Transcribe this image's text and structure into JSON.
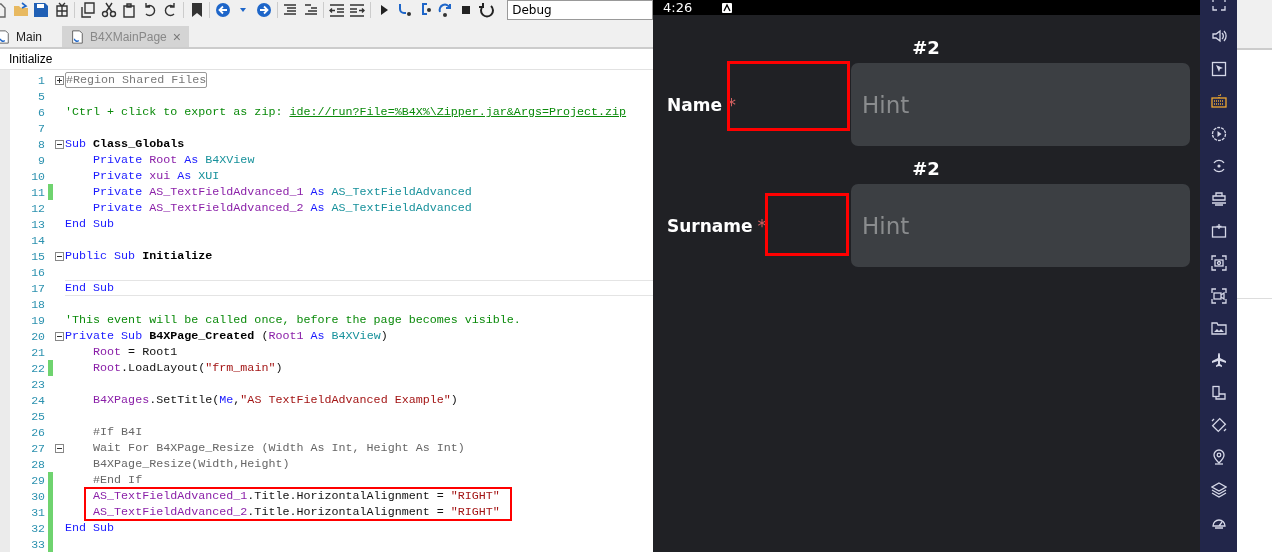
{
  "toolbar": {
    "configuration": "Debug"
  },
  "tabs": [
    {
      "label": "Main",
      "selected": false
    },
    {
      "label": "B4XMainPage",
      "selected": true,
      "close": "×"
    }
  ],
  "member_dropdown": {
    "value": "Initialize"
  },
  "code_lines": [
    {
      "number": "1",
      "collapsible": true,
      "collapsed": true,
      "changed": false,
      "current": false,
      "tokens": [
        {
          "t": "#Region Shared Files",
          "kind": "region"
        }
      ]
    },
    {
      "number": "5",
      "collapsible": false,
      "changed": false,
      "current": false
    },
    {
      "number": "6",
      "collapsible": false,
      "changed": false,
      "current": false,
      "tokens": [
        {
          "t": "'Ctrl + click to export as zip: ",
          "kind": "comment"
        },
        {
          "t": "ide://run?File=%B4X%\\Zipper.jar&Args=Project.zip",
          "kind": "link"
        }
      ]
    },
    {
      "number": "7",
      "collapsible": false,
      "changed": false,
      "current": false
    },
    {
      "number": "8",
      "collapsible": true,
      "collapsed": false,
      "changed": false,
      "current": false,
      "tokens": [
        {
          "t": "Sub ",
          "kind": "keyword"
        },
        {
          "t": "Class_Globals",
          "kind": "bold"
        }
      ]
    },
    {
      "number": "9",
      "collapsible": false,
      "changed": false,
      "current": false,
      "tokens": [
        {
          "t": "    Private ",
          "kind": "keyword"
        },
        {
          "t": "Root ",
          "kind": "ident"
        },
        {
          "t": "As ",
          "kind": "keyword"
        },
        {
          "t": "B4XView",
          "kind": "type"
        }
      ]
    },
    {
      "number": "10",
      "collapsible": false,
      "changed": false,
      "current": false,
      "tokens": [
        {
          "t": "    Private ",
          "kind": "keyword"
        },
        {
          "t": "xui ",
          "kind": "ident"
        },
        {
          "t": "As ",
          "kind": "keyword"
        },
        {
          "t": "XUI",
          "kind": "type"
        }
      ]
    },
    {
      "number": "11",
      "collapsible": false,
      "changed": true,
      "current": false,
      "tokens": [
        {
          "t": "    Private ",
          "kind": "keyword"
        },
        {
          "t": "AS_TextFieldAdvanced_1 ",
          "kind": "ident"
        },
        {
          "t": "As ",
          "kind": "keyword"
        },
        {
          "t": "AS_TextFieldAdvanced",
          "kind": "type"
        }
      ]
    },
    {
      "number": "12",
      "collapsible": false,
      "changed": false,
      "current": false,
      "tokens": [
        {
          "t": "    Private ",
          "kind": "keyword"
        },
        {
          "t": "AS_TextFieldAdvanced_2 ",
          "kind": "ident"
        },
        {
          "t": "As ",
          "kind": "keyword"
        },
        {
          "t": "AS_TextFieldAdvanced",
          "kind": "type"
        }
      ]
    },
    {
      "number": "13",
      "collapsible": false,
      "changed": false,
      "current": false,
      "tokens": [
        {
          "t": "End Sub",
          "kind": "keyword"
        }
      ]
    },
    {
      "number": "14",
      "collapsible": false,
      "changed": false,
      "current": false
    },
    {
      "number": "15",
      "collapsible": true,
      "collapsed": false,
      "changed": false,
      "current": false,
      "tokens": [
        {
          "t": "Public Sub ",
          "kind": "keyword"
        },
        {
          "t": "Initialize",
          "kind": "bold"
        }
      ]
    },
    {
      "number": "16",
      "collapsible": false,
      "changed": false,
      "current": false
    },
    {
      "number": "17",
      "collapsible": false,
      "changed": false,
      "current": true,
      "tokens": [
        {
          "t": "End Sub",
          "kind": "keyword"
        }
      ]
    },
    {
      "number": "18",
      "collapsible": false,
      "changed": false,
      "current": false
    },
    {
      "number": "19",
      "collapsible": false,
      "changed": false,
      "current": false,
      "tokens": [
        {
          "t": "'This event will be called once, before the page becomes visible.",
          "kind": "comment"
        }
      ]
    },
    {
      "number": "20",
      "collapsible": true,
      "collapsed": false,
      "changed": false,
      "current": false,
      "tokens": [
        {
          "t": "Private Sub ",
          "kind": "keyword"
        },
        {
          "t": "B4XPage_Created",
          "kind": "bold"
        },
        {
          "t": " (",
          "kind": "plain"
        },
        {
          "t": "Root1 ",
          "kind": "ident"
        },
        {
          "t": "As ",
          "kind": "keyword"
        },
        {
          "t": "B4XView",
          "kind": "type"
        },
        {
          "t": ")",
          "kind": "plain"
        }
      ]
    },
    {
      "number": "21",
      "collapsible": false,
      "changed": false,
      "current": false,
      "tokens": [
        {
          "t": "    Root",
          "kind": "ident"
        },
        {
          "t": " = Root1",
          "kind": "plain"
        }
      ]
    },
    {
      "number": "22",
      "collapsible": false,
      "changed": true,
      "current": false,
      "tokens": [
        {
          "t": "    Root",
          "kind": "ident"
        },
        {
          "t": ".LoadLayout(",
          "kind": "plain"
        },
        {
          "t": "\"frm_main\"",
          "kind": "string"
        },
        {
          "t": ")",
          "kind": "plain"
        }
      ]
    },
    {
      "number": "23",
      "collapsible": false,
      "changed": false,
      "current": false
    },
    {
      "number": "24",
      "collapsible": false,
      "changed": false,
      "current": false,
      "tokens": [
        {
          "t": "    B4XPages",
          "kind": "ident"
        },
        {
          "t": ".SetTitle(",
          "kind": "plain"
        },
        {
          "t": "Me",
          "kind": "keyword"
        },
        {
          "t": ",",
          "kind": "plain"
        },
        {
          "t": "\"AS TextFieldAdvanced Example\"",
          "kind": "string"
        },
        {
          "t": ")",
          "kind": "plain"
        }
      ]
    },
    {
      "number": "25",
      "collapsible": false,
      "changed": false,
      "current": false
    },
    {
      "number": "26",
      "collapsible": false,
      "changed": false,
      "current": false,
      "tokens": [
        {
          "t": "    #If B4I",
          "kind": "inactive"
        }
      ]
    },
    {
      "number": "27",
      "collapsible": true,
      "collapsed": false,
      "changed": false,
      "current": false,
      "tokens": [
        {
          "t": "    Wait For B4XPage_Resize (Width As Int, Height As Int)",
          "kind": "inactive"
        }
      ]
    },
    {
      "number": "28",
      "collapsible": false,
      "changed": false,
      "current": false,
      "tokens": [
        {
          "t": "    B4XPage_Resize(Width,Height)",
          "kind": "inactive"
        }
      ]
    },
    {
      "number": "29",
      "collapsible": false,
      "changed": true,
      "current": false,
      "tokens": [
        {
          "t": "    #End If",
          "kind": "inactive"
        }
      ]
    },
    {
      "number": "30",
      "collapsible": false,
      "changed": true,
      "current": false,
      "tokens": [
        {
          "t": "    AS_TextFieldAdvanced_1",
          "kind": "ident"
        },
        {
          "t": ".Title.HorizontalAlignment = ",
          "kind": "plain"
        },
        {
          "t": "\"RIGHT\"",
          "kind": "string"
        }
      ]
    },
    {
      "number": "31",
      "collapsible": false,
      "changed": true,
      "current": false,
      "tokens": [
        {
          "t": "    AS_TextFieldAdvanced_2",
          "kind": "ident"
        },
        {
          "t": ".Title.HorizontalAlignment = ",
          "kind": "plain"
        },
        {
          "t": "\"RIGHT\"",
          "kind": "string"
        }
      ]
    },
    {
      "number": "32",
      "collapsible": false,
      "changed": true,
      "current": false,
      "tokens": [
        {
          "t": "End Sub",
          "kind": "keyword"
        }
      ]
    },
    {
      "number": "33",
      "collapsible": false,
      "changed": true,
      "current": false
    }
  ],
  "emulator": {
    "status_time": "4:26",
    "fields": [
      {
        "title": "#2",
        "label": "Name",
        "required": "*",
        "placeholder": "Hint"
      },
      {
        "title": "#2",
        "label": "Surname",
        "required": "*",
        "placeholder": "Hint"
      }
    ]
  },
  "emulator_toolbar": [
    {
      "selected": false
    },
    {
      "selected": false
    },
    {
      "selected": false
    },
    {
      "selected": true
    },
    {
      "selected": false
    },
    {
      "selected": false
    },
    {
      "selected": false
    },
    {
      "selected": false
    },
    {
      "selected": false
    },
    {
      "selected": false
    },
    {
      "selected": false
    },
    {
      "selected": false
    },
    {
      "selected": false
    },
    {
      "selected": false
    },
    {
      "selected": false
    },
    {
      "selected": false
    },
    {
      "selected": false
    }
  ]
}
